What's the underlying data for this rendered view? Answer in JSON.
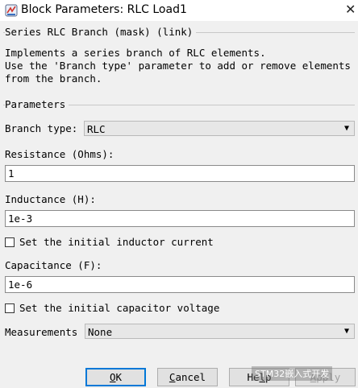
{
  "window": {
    "title": "Block Parameters: RLC Load1",
    "close_glyph": "✕",
    "icon": "simulink-block-icon"
  },
  "mask_header": "Series RLC Branch (mask) (link)",
  "description": "Implements a series branch of RLC elements.\nUse the 'Branch type' parameter to add or remove elements\nfrom the branch.",
  "parameters_group": "Parameters",
  "branch_type": {
    "label": "Branch type:",
    "value": "RLC"
  },
  "resistance": {
    "label": "Resistance (Ohms):",
    "value": "1"
  },
  "inductance": {
    "label": "Inductance (H):",
    "value": "1e-3"
  },
  "init_inductor": {
    "label": "Set the initial inductor current",
    "checked": false
  },
  "capacitance": {
    "label": "Capacitance (F):",
    "value": "1e-6"
  },
  "init_capacitor": {
    "label": "Set the initial capacitor voltage",
    "checked": false
  },
  "measurements": {
    "label": "Measurements",
    "value": "None"
  },
  "buttons": {
    "ok": {
      "mnemonic": "O",
      "rest": "K"
    },
    "cancel": {
      "mnemonic": "C",
      "rest": "ancel"
    },
    "help": {
      "first": "He",
      "mnemonic": "l",
      "rest": "p"
    },
    "apply": {
      "mnemonic": "A",
      "rest": "pply"
    }
  },
  "watermark": "STM32嵌入式开发"
}
